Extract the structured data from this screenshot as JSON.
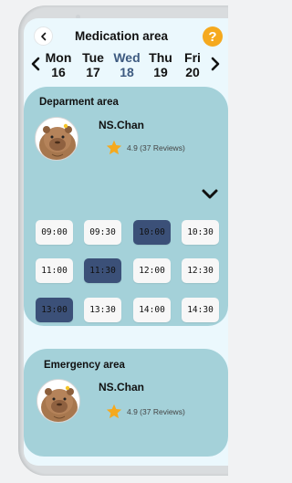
{
  "header": {
    "title": "Medication area",
    "help_label": "?"
  },
  "days": [
    {
      "name": "Mon",
      "num": "16",
      "active": false
    },
    {
      "name": "Tue",
      "num": "17",
      "active": false
    },
    {
      "name": "Wed",
      "num": "18",
      "active": true
    },
    {
      "name": "Thu",
      "num": "19",
      "active": false
    },
    {
      "name": "Fri",
      "num": "20",
      "active": false
    }
  ],
  "department": {
    "title": "Deparment area",
    "doctor": "NS.Chan",
    "rating": "4.9 (37 Reviews)",
    "slots": [
      {
        "time": "09:00",
        "selected": false
      },
      {
        "time": "09:30",
        "selected": false
      },
      {
        "time": "10:00",
        "selected": true
      },
      {
        "time": "10:30",
        "selected": false
      },
      {
        "time": "11:00",
        "selected": false
      },
      {
        "time": "11:30",
        "selected": true
      },
      {
        "time": "12:00",
        "selected": false
      },
      {
        "time": "12:30",
        "selected": false
      },
      {
        "time": "13:00",
        "selected": true
      },
      {
        "time": "13:30",
        "selected": false
      },
      {
        "time": "14:00",
        "selected": false
      },
      {
        "time": "14:30",
        "selected": false
      }
    ]
  },
  "emergency": {
    "title": "Emergency area",
    "doctor": "NS.Chan",
    "rating": "4.9 (37 Reviews)"
  },
  "colors": {
    "accent": "#3d5a80",
    "card": "#a4d1d9",
    "slot_selected": "#3b5078",
    "star": "#f5a91e",
    "help": "#f5a91e"
  },
  "icons": [
    "back-icon",
    "help-icon",
    "chevron-left-icon",
    "chevron-right-icon",
    "star-icon",
    "chevron-down-icon",
    "capybara-avatar"
  ]
}
